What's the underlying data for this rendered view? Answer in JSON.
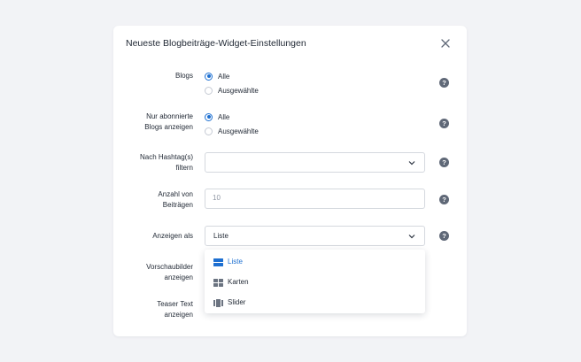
{
  "dialog": {
    "title": "Neueste Blogbeiträge-Widget-Einstellungen"
  },
  "fields": {
    "blogs": {
      "label": "Blogs",
      "options": [
        "Alle",
        "Ausgewählte"
      ],
      "selected": "Alle"
    },
    "subscribed": {
      "label_line1": "Nur abonnierte",
      "label_line2": "Blogs anzeigen",
      "options": [
        "Alle",
        "Ausgewählte"
      ],
      "selected": "Alle"
    },
    "hashtags": {
      "label_line1": "Nach Hashtag(s)",
      "label_line2": "filtern",
      "value": ""
    },
    "count": {
      "label_line1": "Anzahl von",
      "label_line2": "Beiträgen",
      "placeholder": "10"
    },
    "display": {
      "label": "Anzeigen als",
      "value": "Liste",
      "options": [
        "Liste",
        "Karten",
        "Slider"
      ]
    },
    "thumbnails": {
      "label_line1": "Vorschaubilder",
      "label_line2": "anzeigen"
    },
    "teaser": {
      "label_line1": "Teaser Text",
      "label_line2": "anzeigen"
    }
  },
  "help_glyph": "?",
  "colors": {
    "accent": "#1d6fd1",
    "help_bg": "#5f6877",
    "icon_gray": "#6b7380"
  }
}
